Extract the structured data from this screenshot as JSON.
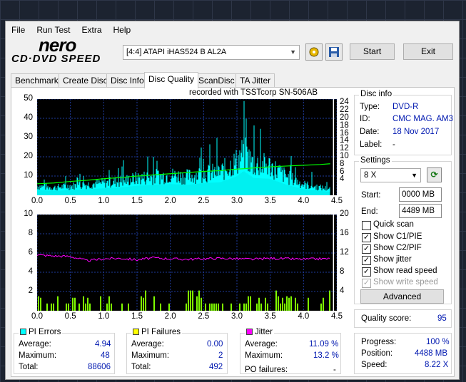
{
  "menu": [
    "File",
    "Run Test",
    "Extra",
    "Help"
  ],
  "logo": {
    "line1": "nero",
    "line2": "CD·DVD SPEED"
  },
  "drive": {
    "value": "[4:4]  ATAPI iHAS524   B AL2A"
  },
  "toolbar": {
    "start": "Start",
    "exit": "Exit"
  },
  "tabs": [
    "Benchmark",
    "Create Disc",
    "Disc Info",
    "Disc Quality",
    "ScanDisc",
    "TA Jitter"
  ],
  "active_tab": "Disc Quality",
  "chart_title": "recorded with TSSTcorp SN-506AB",
  "disc_info": {
    "title": "Disc info",
    "type_lbl": "Type:",
    "type": "DVD-R",
    "id_lbl": "ID:",
    "id": "CMC MAG. AM3",
    "date_lbl": "Date:",
    "date": "18 Nov 2017",
    "label_lbl": "Label:",
    "label": "-"
  },
  "settings": {
    "title": "Settings",
    "speed": "8 X",
    "start_lbl": "Start:",
    "start": "0000 MB",
    "end_lbl": "End:",
    "end": "4489 MB",
    "quick_scan": "Quick scan",
    "show_c1": "Show C1/PIE",
    "show_c2": "Show C2/PIF",
    "show_jitter": "Show jitter",
    "show_read": "Show read speed",
    "show_write": "Show write speed",
    "advanced": "Advanced"
  },
  "quality": {
    "label": "Quality score:",
    "value": "95"
  },
  "progress": {
    "progress_lbl": "Progress:",
    "progress": "100 %",
    "position_lbl": "Position:",
    "position": "4488 MB",
    "speed_lbl": "Speed:",
    "speed": "8.22 X"
  },
  "pi_errors": {
    "title": "PI Errors",
    "color": "#00ffff",
    "avg_lbl": "Average:",
    "avg": "4.94",
    "max_lbl": "Maximum:",
    "max": "48",
    "total_lbl": "Total:",
    "total": "88606"
  },
  "pi_failures": {
    "title": "PI Failures",
    "color": "#ffff00",
    "avg_lbl": "Average:",
    "avg": "0.00",
    "max_lbl": "Maximum:",
    "max": "2",
    "total_lbl": "Total:",
    "total": "492"
  },
  "jitter": {
    "title": "Jitter",
    "color": "#ff00ff",
    "avg_lbl": "Average:",
    "avg": "11.09 %",
    "max_lbl": "Maximum:",
    "max": "13.2 %",
    "po_lbl": "PO failures:",
    "po": "-"
  },
  "chart_data": [
    {
      "type": "area",
      "series": [
        {
          "name": "PI Errors",
          "color": "#00ffff"
        },
        {
          "name": "read speed",
          "color": "#00ff00"
        }
      ],
      "x": [
        0,
        0.25,
        0.5,
        0.75,
        1.0,
        1.25,
        1.5,
        1.75,
        2.0,
        2.25,
        2.5,
        2.75,
        3.0,
        3.1,
        3.25,
        3.5,
        3.75,
        4.0,
        4.25,
        4.4
      ],
      "pi": [
        6,
        5,
        6,
        7,
        8,
        9,
        11,
        12,
        13,
        12,
        14,
        15,
        22,
        28,
        20,
        19,
        12,
        7,
        5,
        4
      ],
      "speed": [
        3.0,
        3.2,
        3.6,
        3.9,
        4.3,
        4.6,
        5.0,
        5.3,
        5.6,
        5.9,
        6.2,
        6.4,
        6.8,
        6.9,
        7.1,
        7.4,
        7.6,
        7.8,
        8.0,
        8.2
      ],
      "xlim": [
        0,
        4.5
      ],
      "ylim_left": [
        0,
        50
      ],
      "ylim_right": [
        0,
        25
      ],
      "yticks_left": [
        10,
        20,
        30,
        40,
        50
      ],
      "yticks_right": [
        4,
        6,
        8,
        10,
        12,
        14,
        16,
        18,
        20,
        22,
        24
      ],
      "xticks": [
        0.0,
        0.5,
        1.0,
        1.5,
        2.0,
        2.5,
        3.0,
        3.5,
        4.0,
        4.5
      ]
    },
    {
      "type": "bar",
      "series": [
        {
          "name": "PI Failures",
          "color": "#7fff00"
        },
        {
          "name": "Jitter",
          "color": "#ff00ff"
        }
      ],
      "x": [
        0,
        0.25,
        0.5,
        0.75,
        1.0,
        1.25,
        1.5,
        1.75,
        2.0,
        2.25,
        2.5,
        2.75,
        3.0,
        3.25,
        3.5,
        3.75,
        4.0,
        4.25,
        4.4
      ],
      "jitter": [
        11.6,
        11.4,
        11.3,
        10.4,
        10.8,
        10.9,
        10.6,
        11.0,
        10.8,
        10.7,
        10.8,
        10.9,
        10.8,
        10.7,
        10.9,
        10.8,
        10.7,
        10.8,
        10.8
      ],
      "xlim": [
        0,
        4.5
      ],
      "ylim_left": [
        0,
        10
      ],
      "ylim_right": [
        0,
        20
      ],
      "yticks_left": [
        2,
        4,
        6,
        8,
        10
      ],
      "yticks_right": [
        4,
        8,
        12,
        16,
        20
      ],
      "xticks": [
        0.0,
        0.5,
        1.0,
        1.5,
        2.0,
        2.5,
        3.0,
        3.5,
        4.0,
        4.5
      ]
    }
  ]
}
